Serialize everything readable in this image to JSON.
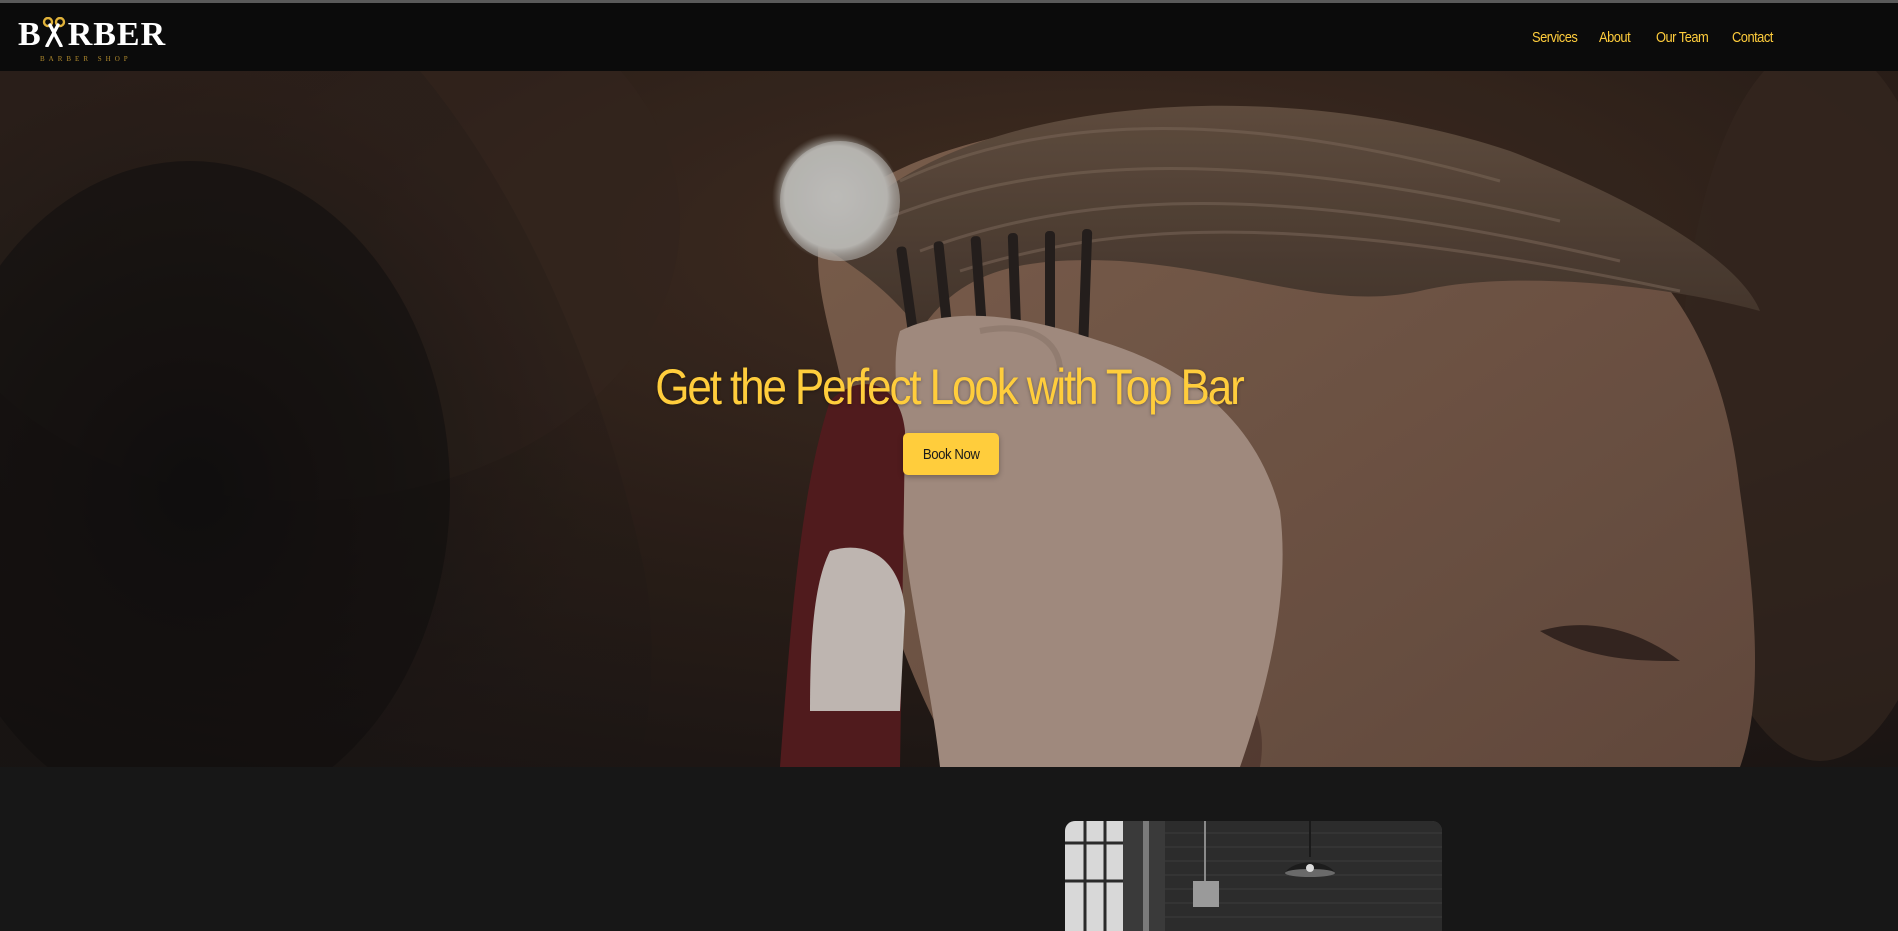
{
  "brand": {
    "logo_text": "BARBER",
    "logo_subtitle": "BARBER SHOP",
    "accent_color": "#ffcd3c"
  },
  "nav": {
    "items": [
      {
        "label": "Services"
      },
      {
        "label": "About"
      },
      {
        "label": "Our Team"
      },
      {
        "label": "Contact"
      }
    ]
  },
  "hero": {
    "title": "Get the Perfect Look with Top Bar",
    "cta_label": "Book Now",
    "image": "barber-cutting-hair-photo"
  },
  "about": {
    "image": "barbershop-interior-photo"
  }
}
